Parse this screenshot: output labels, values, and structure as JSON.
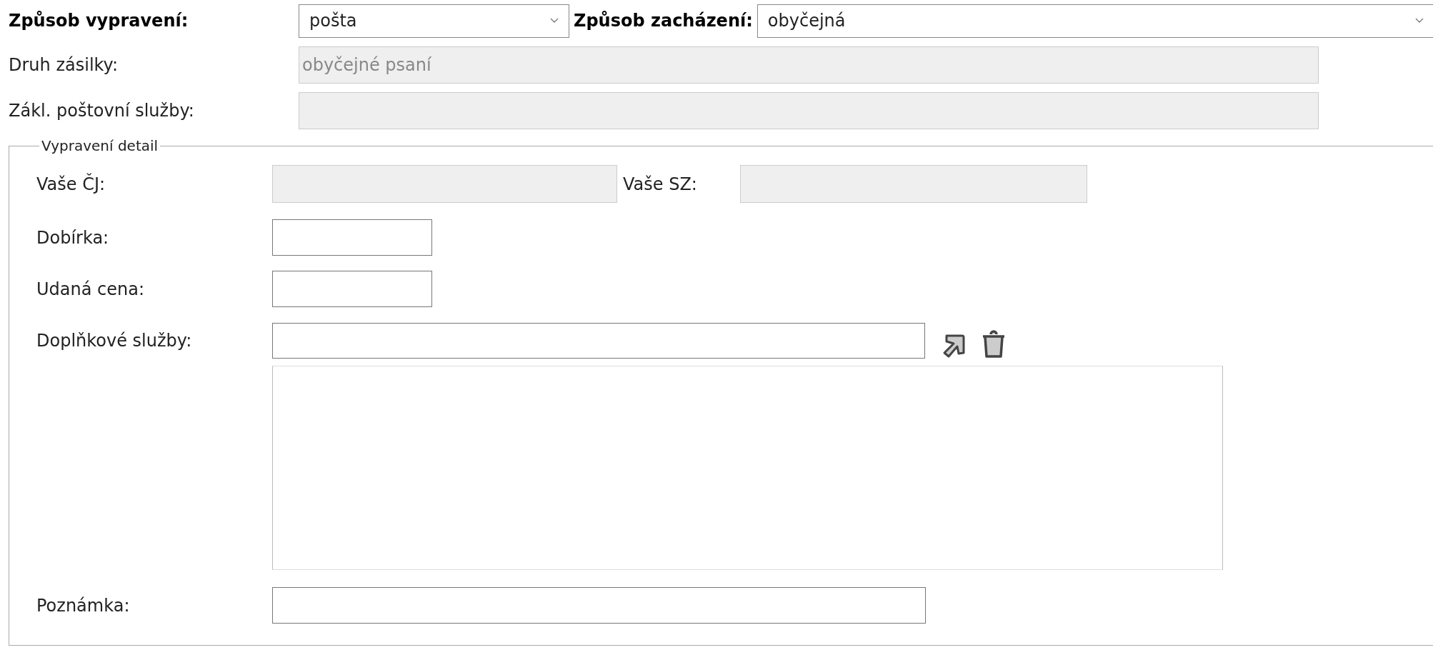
{
  "header": {
    "shipping_method": {
      "label": "Způsob vypravení:",
      "value": "pošta"
    },
    "handling": {
      "label": "Způsob zacházení:",
      "value": "obyčejná"
    }
  },
  "fields": [
    {
      "label": "Druh zásilky:",
      "value": "obyčejné psaní",
      "disabled": true
    },
    {
      "label": "Zákl. poštovní služby:",
      "disabled": true
    }
  ],
  "detail": {
    "legend": "Vypravení detail",
    "your_ref": {
      "label": "Vaše ČJ:",
      "disabled": true
    },
    "your_sz": {
      "label": "Vaše SZ:",
      "disabled": true
    },
    "cod": {
      "label": "Dobírka:",
      "disabled": false
    },
    "declared_value": {
      "label": "Udaná cena:",
      "disabled": false
    },
    "extra_services": {
      "label": "Doplňkové služby:",
      "disabled": false
    },
    "note": {
      "label": "Poznámka:",
      "disabled": false
    }
  }
}
